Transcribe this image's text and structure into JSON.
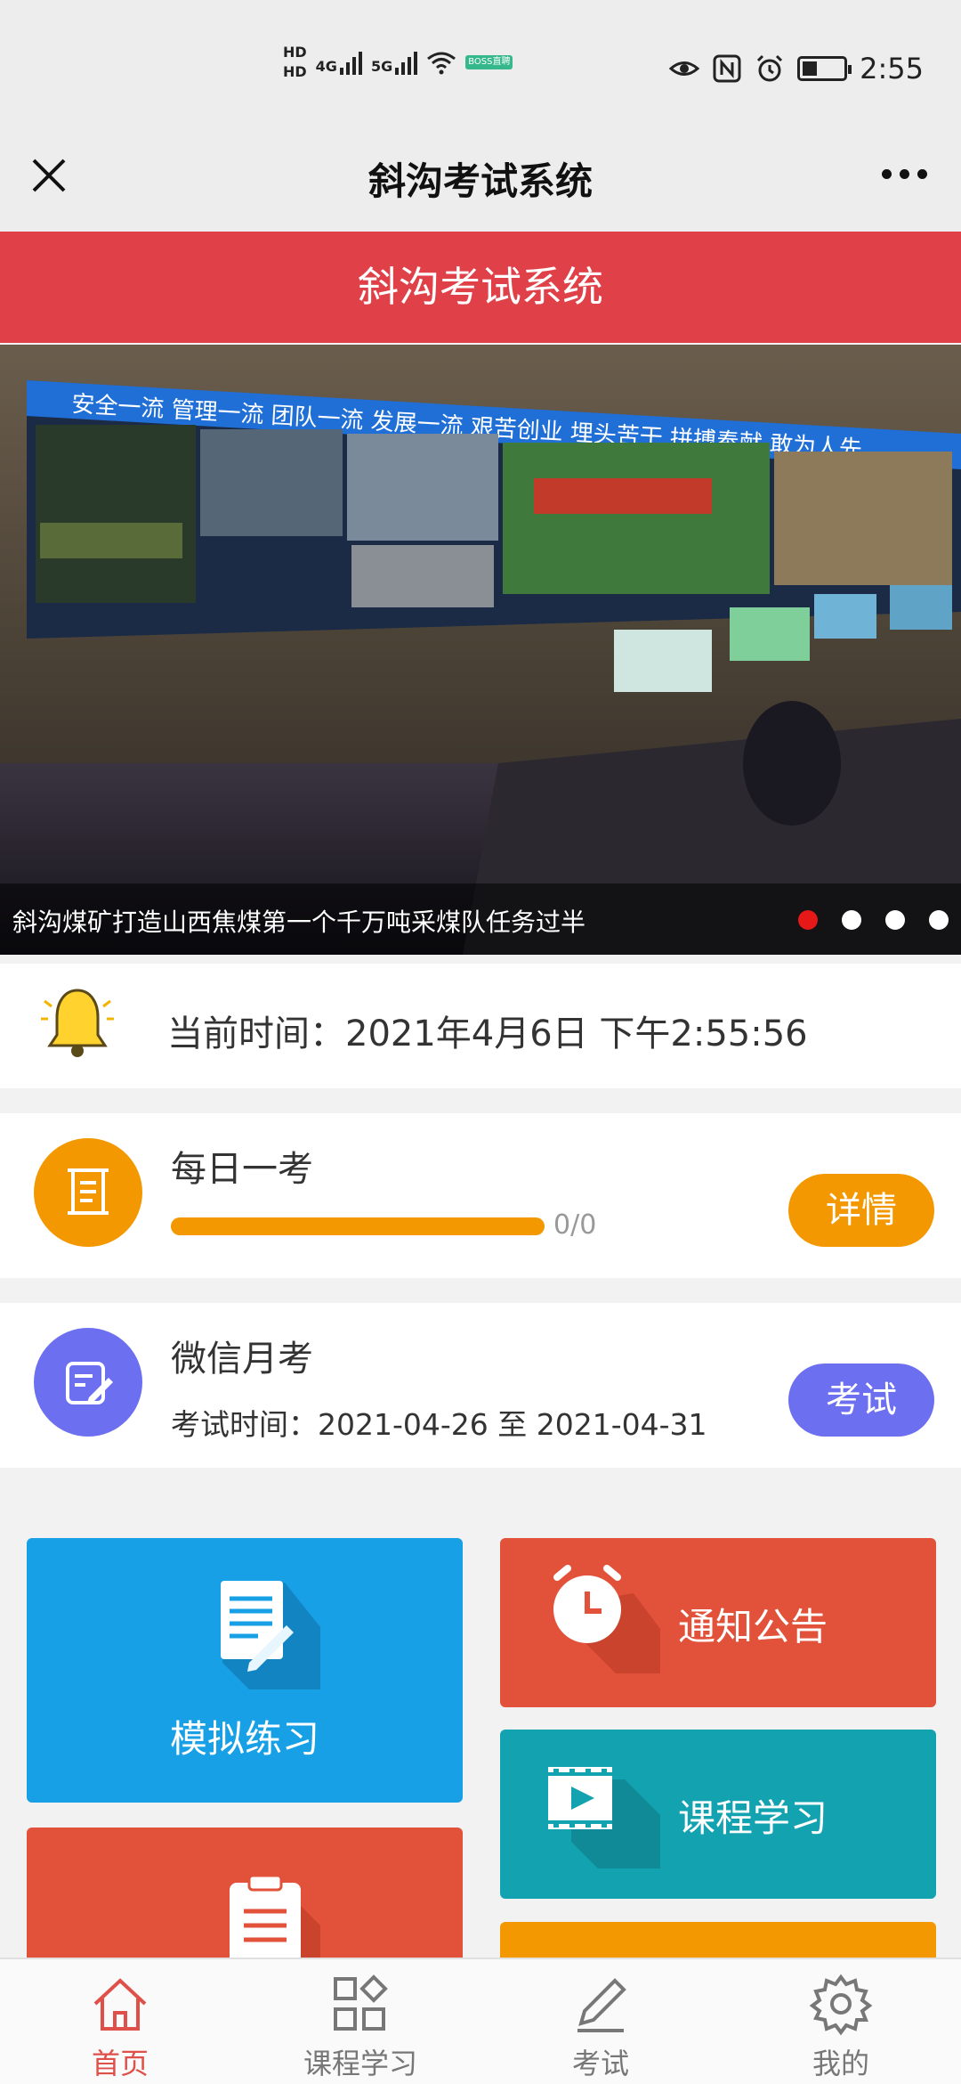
{
  "status_bar": {
    "hd_top": "HD",
    "hd_bottom": "HD",
    "net1": "4G",
    "net2": "5G",
    "boss_badge": "BOSS直聘",
    "time": "2:55"
  },
  "nav": {
    "title": "斜沟考试系统"
  },
  "header": {
    "title": "斜沟考试系统"
  },
  "carousel": {
    "caption": "斜沟煤矿打造山西焦煤第一个千万吨采煤队任务过半",
    "banner_text": "安全一流  管理一流  团队一流  发展一流  艰苦创业  埋头苦干  拼搏奉献  敢为人先",
    "active_index": 0,
    "slide_count": 4
  },
  "time_card": {
    "label": "当前时间：2021年4月6日 下午2:55:56"
  },
  "daily_exam": {
    "title": "每日一考",
    "progress_text": "0/0",
    "button": "详情"
  },
  "monthly_exam": {
    "title": "微信月考",
    "subtitle": "考试时间：2021-04-26 至 2021-04-31",
    "button": "考试"
  },
  "tiles": {
    "practice": "模拟练习",
    "notice": "通知公告",
    "course": "课程学习"
  },
  "tabbar": {
    "home": "首页",
    "course": "课程学习",
    "exam": "考试",
    "mine": "我的"
  },
  "colors": {
    "red_header": "#e04148",
    "orange": "#f39800",
    "purple": "#6b6ff0",
    "blue_tile": "#17a0e6",
    "red_tile": "#e2523a",
    "teal_tile": "#13a2b0",
    "active_tab": "#e0504a"
  }
}
